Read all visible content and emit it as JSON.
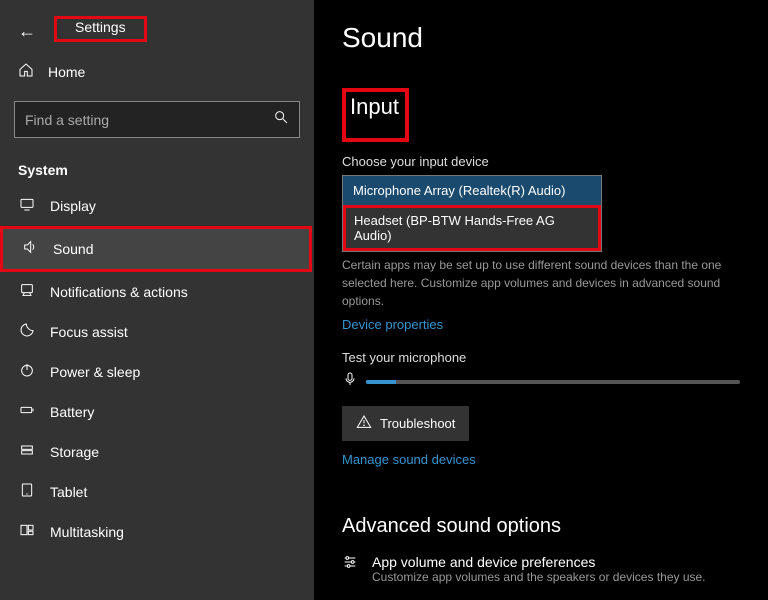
{
  "header": {
    "title": "Settings"
  },
  "sidebar": {
    "home": "Home",
    "search_placeholder": "Find a setting",
    "system_label": "System",
    "items": [
      {
        "icon": "display",
        "label": "Display"
      },
      {
        "icon": "sound",
        "label": "Sound"
      },
      {
        "icon": "notifications",
        "label": "Notifications & actions"
      },
      {
        "icon": "focus",
        "label": "Focus assist"
      },
      {
        "icon": "power",
        "label": "Power & sleep"
      },
      {
        "icon": "battery",
        "label": "Battery"
      },
      {
        "icon": "storage",
        "label": "Storage"
      },
      {
        "icon": "tablet",
        "label": "Tablet"
      },
      {
        "icon": "multitask",
        "label": "Multitasking"
      }
    ]
  },
  "main": {
    "page_title": "Sound",
    "input_section": "Input",
    "choose_label": "Choose your input device",
    "dropdown": {
      "option1": "Microphone Array (Realtek(R) Audio)",
      "option2": "Headset (BP-BTW Hands-Free AG Audio)"
    },
    "hint": "Certain apps may be set up to use different sound devices than the one selected here. Customize app volumes and devices in advanced sound options.",
    "device_props": "Device properties",
    "test_mic": "Test your microphone",
    "troubleshoot": "Troubleshoot",
    "manage": "Manage sound devices",
    "advanced_title": "Advanced sound options",
    "pref_title": "App volume and device preferences",
    "pref_sub": "Customize app volumes and the speakers or devices they use."
  }
}
